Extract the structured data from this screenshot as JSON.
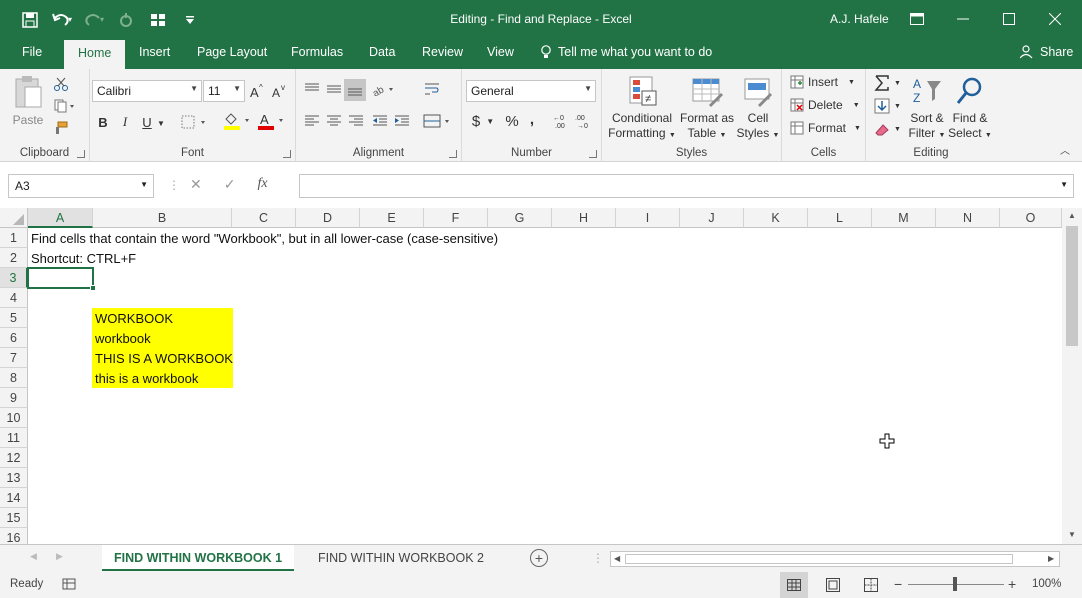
{
  "window": {
    "title": "Editing - Find and Replace  -  Excel",
    "user": "A.J. Hafele"
  },
  "tabs": [
    "File",
    "Home",
    "Insert",
    "Page Layout",
    "Formulas",
    "Data",
    "Review",
    "View"
  ],
  "tell_me": "Tell me what you want to do",
  "share": "Share",
  "ribbon": {
    "clipboard": {
      "label": "Clipboard",
      "paste": "Paste"
    },
    "font": {
      "label": "Font",
      "name": "Calibri",
      "size": "11",
      "bold": "B",
      "italic": "I",
      "underline": "U"
    },
    "alignment": {
      "label": "Alignment"
    },
    "number": {
      "label": "Number",
      "format": "General",
      "currency": "$",
      "percent": "%",
      "comma": ","
    },
    "styles": {
      "label": "Styles",
      "conditional_1": "Conditional",
      "conditional_2": "Formatting",
      "format_table_1": "Format as",
      "format_table_2": "Table",
      "cell_styles_1": "Cell",
      "cell_styles_2": "Styles"
    },
    "cells": {
      "label": "Cells",
      "insert": "Insert",
      "delete": "Delete",
      "format": "Format"
    },
    "editing": {
      "label": "Editing",
      "sort_1": "Sort &",
      "sort_2": "Filter",
      "find_1": "Find &",
      "find_2": "Select"
    }
  },
  "formula_bar": {
    "name_box": "A3",
    "fx": "fx",
    "formula": ""
  },
  "columns": [
    "A",
    "B",
    "C",
    "D",
    "E",
    "F",
    "G",
    "H",
    "I",
    "J",
    "K",
    "L",
    "M",
    "N",
    "O"
  ],
  "rows": [
    "1",
    "2",
    "3",
    "4",
    "5",
    "6",
    "7",
    "8",
    "9",
    "10",
    "11",
    "12",
    "13",
    "14",
    "15",
    "16"
  ],
  "cells": {
    "a1": "Find cells that contain the word \"Workbook\", but in all lower-case (case-sensitive)",
    "a2": "Shortcut: CTRL+F",
    "b5": "WORKBOOK",
    "b6": "workbook",
    "b7": "THIS IS A WORKBOOK",
    "b8": "this is a workbook"
  },
  "sheets": [
    "FIND WITHIN WORKBOOK 1",
    "FIND WITHIN WORKBOOK 2"
  ],
  "status": {
    "ready": "Ready",
    "zoom": "100%"
  },
  "colors": {
    "accent": "#217346",
    "highlight": "#ffff00"
  }
}
